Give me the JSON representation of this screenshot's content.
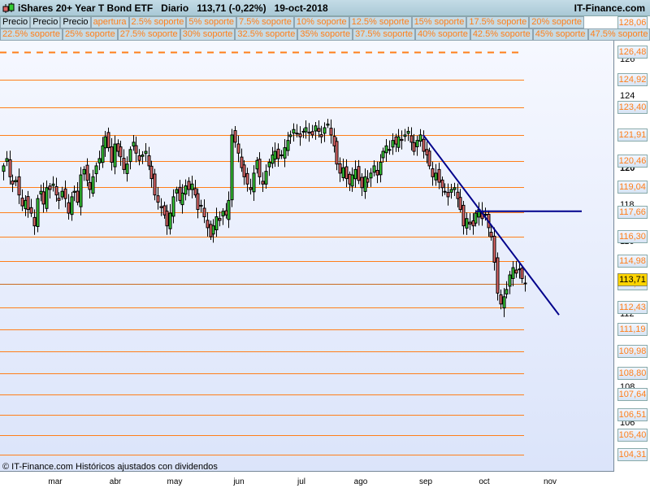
{
  "header": {
    "title": "iShares 20+ Year T Bond ETF   Diario   113,71 (-0,22%)   19-oct-2018",
    "site": "IT-Finance.com"
  },
  "legend_row1": [
    "Precio",
    "Precio",
    "Precio",
    "apertura",
    "2.5% soporte",
    "5% soporte",
    "7.5% soporte",
    "10% soporte",
    "12.5% soporte",
    "15% soporte",
    "17.5% soporte",
    "20% soporte"
  ],
  "legend_row2": [
    "22.5% soporte",
    "25% soporte",
    "27.5% soporte",
    "30% soporte",
    "32.5% soporte",
    "35% soporte",
    "37.5% soporte",
    "40% soporte",
    "42.5% soporte",
    "45% soporte",
    "47.5% soporte"
  ],
  "footer": "© IT-Finance.com  Históricos ajustados con dividendos",
  "colors": {
    "up": "#33cc33",
    "down": "#e06666",
    "level": "#ff7f1a",
    "trend": "#00008b",
    "current": "#ffd400"
  },
  "chart_data": {
    "type": "candlestick",
    "title": "iShares 20+ Year T Bond ETF",
    "period": "Diario",
    "last": 113.71,
    "change_pct": -0.22,
    "date": "19-oct-2018",
    "x_tick_labels": [
      "mar",
      "abr",
      "may",
      "jun",
      "jul",
      "ago",
      "sep",
      "oct",
      "nov"
    ],
    "y_ticks": [
      126,
      124,
      122,
      120,
      118,
      116,
      114,
      112,
      110,
      108,
      106
    ],
    "ylim": [
      103.5,
      128.6
    ],
    "closes": [
      120.2,
      120.6,
      119.6,
      119.2,
      119.4,
      118.6,
      118.0,
      118.3,
      117.8,
      117.6,
      116.9,
      118.4,
      118.8,
      118.1,
      119.0,
      118.9,
      119.2,
      118.6,
      118.3,
      118.8,
      118.4,
      117.6,
      118.5,
      118.8,
      118.2,
      119.7,
      120.0,
      119.4,
      118.9,
      119.6,
      120.2,
      120.6,
      121.3,
      121.8,
      121.2,
      120.4,
      121.4,
      121.0,
      120.7,
      120.0,
      120.3,
      121.1,
      121.5,
      120.9,
      120.5,
      120.8,
      121.0,
      120.2,
      119.5,
      118.6,
      118.2,
      117.9,
      117.5,
      116.9,
      117.6,
      118.5,
      118.9,
      118.3,
      118.7,
      119.1,
      118.9,
      119.2,
      118.6,
      117.8,
      118.0,
      117.4,
      116.8,
      116.3,
      116.9,
      117.4,
      117.2,
      117.7,
      117.5,
      118.3,
      121.9,
      121.5,
      120.9,
      120.1,
      119.6,
      119.2,
      118.9,
      119.8,
      120.5,
      119.6,
      119.2,
      119.9,
      120.4,
      120.8,
      121.0,
      120.6,
      120.8,
      121.2,
      121.6,
      121.9,
      122.2,
      122.0,
      121.8,
      122.1,
      122.3,
      122.0,
      121.9,
      122.4,
      122.1,
      121.8,
      122.3,
      122.5,
      121.9,
      121.3,
      120.3,
      119.8,
      120.1,
      119.5,
      119.2,
      119.7,
      120.0,
      119.4,
      119.0,
      119.6,
      119.3,
      119.8,
      120.2,
      119.7,
      120.4,
      121.0,
      121.3,
      121.1,
      121.6,
      121.4,
      121.8,
      121.6,
      121.9,
      122.1,
      121.5,
      121.0,
      121.6,
      121.9,
      121.0,
      120.8,
      120.2,
      119.6,
      119.8,
      119.3,
      119.0,
      118.8,
      118.5,
      118.9,
      119.0,
      118.4,
      117.8,
      116.9,
      117.3,
      117.0,
      116.9,
      117.6,
      117.8,
      117.3,
      117.5,
      116.8,
      116.3,
      114.9,
      113.2,
      112.6,
      113.0,
      113.4,
      114.2,
      114.6,
      114.3,
      114.5,
      114.0,
      113.71
    ],
    "open_level": 128.06,
    "support_levels": [
      126.48,
      124.92,
      123.4,
      121.91,
      120.46,
      119.04,
      117.66,
      116.3,
      114.98,
      113.69,
      112.43,
      111.19,
      109.98,
      108.8,
      107.64,
      106.51,
      105.4,
      104.31
    ],
    "current_label": "113,71",
    "level_labels": [
      "128,06",
      "126,48",
      "124,92",
      "123,40",
      "121,91",
      "120,46",
      "119,04",
      "117,66",
      "116,30",
      "114,98",
      "113,69",
      "112,43",
      "111,19",
      "109,98",
      "108,80",
      "107,64",
      "106,51",
      "105,40",
      "104,31"
    ],
    "trendline": {
      "from_index": 136,
      "from_price": 121.9,
      "to_index": 180,
      "to_price": 112.0
    },
    "horizontal_line": {
      "price": 117.7,
      "from_index": 153
    }
  }
}
